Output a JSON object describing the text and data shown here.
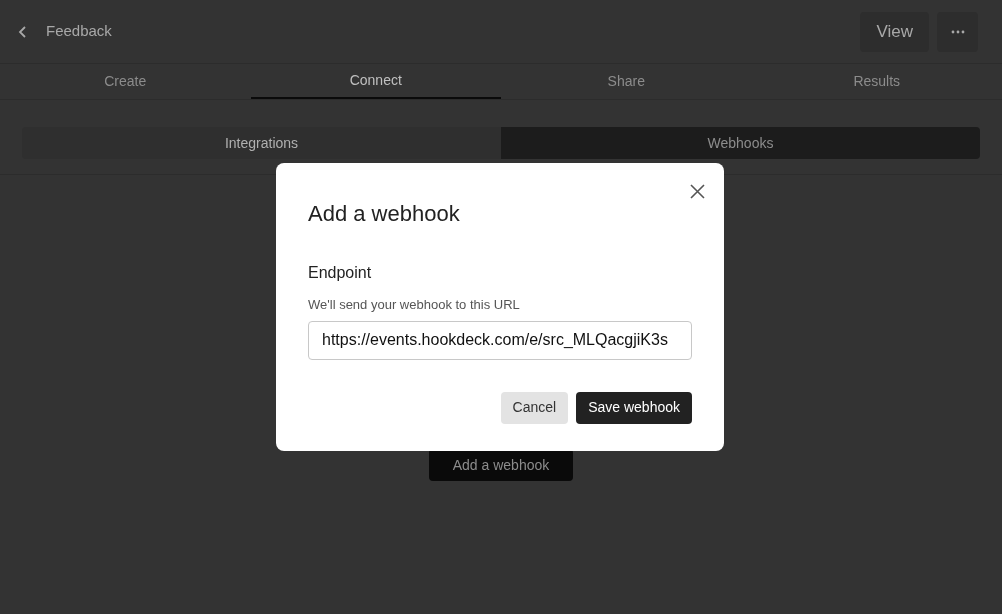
{
  "header": {
    "title": "Feedback",
    "buttons": [
      {
        "kind": "text",
        "label": "View"
      },
      {
        "kind": "more"
      }
    ]
  },
  "tabs": [
    {
      "label": "Create",
      "selected": false
    },
    {
      "label": "Connect",
      "selected": true
    },
    {
      "label": "Share",
      "selected": false
    },
    {
      "label": "Results",
      "selected": false
    }
  ],
  "subtabs": [
    {
      "label": "Integrations",
      "selected": false
    },
    {
      "label": "Webhooks",
      "selected": true
    }
  ],
  "background_button": "Add a webhook",
  "dialog": {
    "title": "Add a webhook",
    "field_label": "Endpoint",
    "field_hint": "We'll send your webhook to this URL",
    "value": "https://events.hookdeck.com/e/src_MLQacgjiK3s",
    "buttons": [
      {
        "kind": "secondary",
        "label": "Cancel"
      },
      {
        "kind": "primary",
        "label": "Save webhook"
      }
    ]
  }
}
